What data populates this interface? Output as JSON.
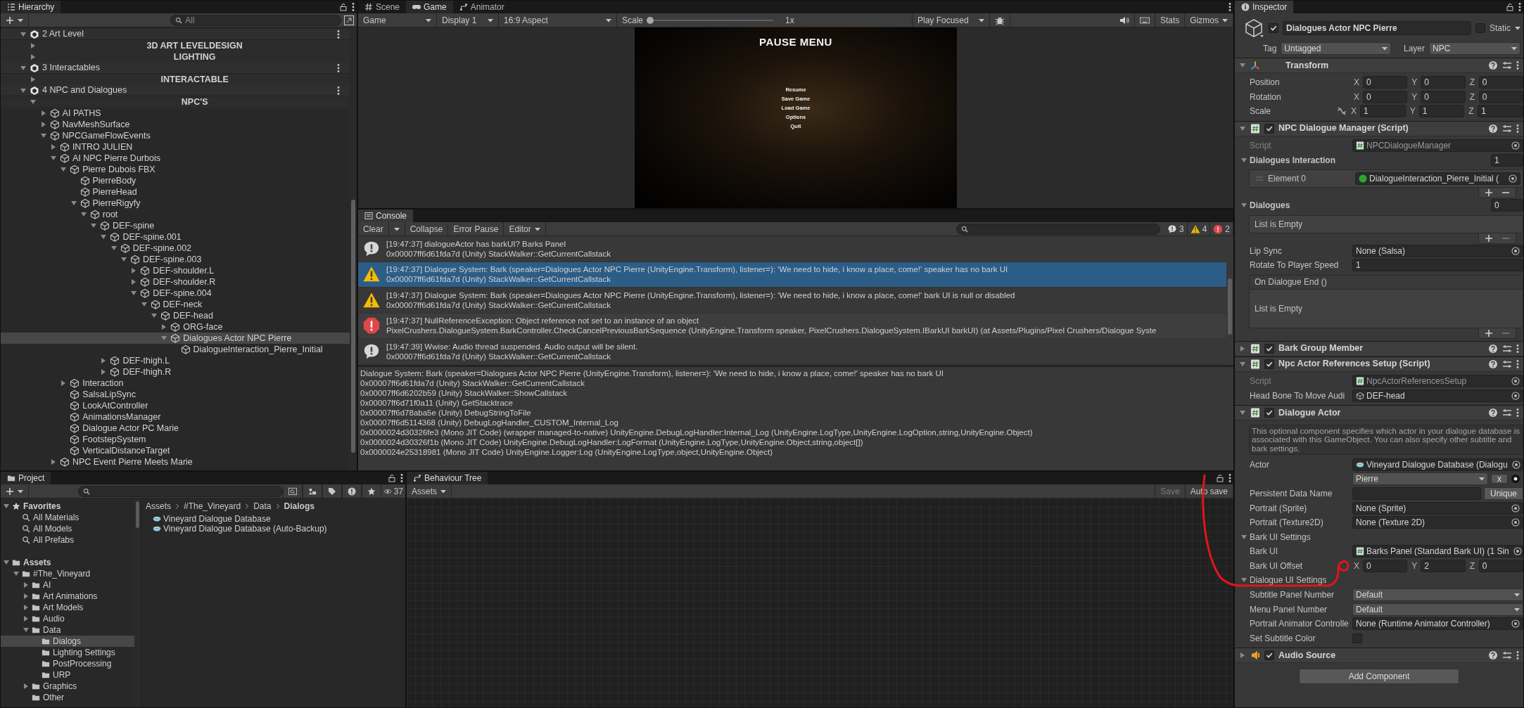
{
  "hierarchy": {
    "tab": "Hierarchy",
    "search": {
      "placeholder": "All"
    },
    "items": [
      {
        "kind": "scene",
        "label": "2 Art Level",
        "expanded": true,
        "selected": false,
        "children": [
          {
            "kind": "header",
            "label": "3D ART LEVELDESIGN",
            "expanded": false,
            "selected": false
          },
          {
            "kind": "header",
            "label": "LIGHTING",
            "expanded": false,
            "selected": false
          }
        ]
      },
      {
        "kind": "scene",
        "label": "3 Interactables",
        "expanded": true,
        "selected": false,
        "children": [
          {
            "kind": "header",
            "label": "INTERACTABLE",
            "expanded": false,
            "selected": false
          }
        ]
      },
      {
        "kind": "scene",
        "label": "4 NPC and Dialogues",
        "expanded": true,
        "selected": false,
        "children": [
          {
            "kind": "header",
            "label": "NPC'S",
            "expanded": true,
            "selected": false,
            "children": [
              {
                "kind": "object",
                "label": "AI PATHS",
                "expanded": false,
                "selected": false
              },
              {
                "kind": "object",
                "label": "NavMeshSurface",
                "expanded": false,
                "selected": false
              },
              {
                "kind": "object",
                "label": "NPCGameFlowEvents",
                "expanded": true,
                "selected": false,
                "children": [
                  {
                    "kind": "object",
                    "label": "INTRO JULIEN",
                    "expanded": false,
                    "selected": false
                  },
                  {
                    "kind": "object",
                    "label": "AI NPC Pierre Durbois",
                    "expanded": true,
                    "selected": false,
                    "children": [
                      {
                        "kind": "object",
                        "label": "Pierre Dubois FBX",
                        "expanded": true,
                        "selected": false,
                        "children": [
                          {
                            "kind": "object",
                            "label": "PierreBody",
                            "selected": false
                          },
                          {
                            "kind": "object",
                            "label": "PierreHead",
                            "selected": false
                          },
                          {
                            "kind": "object",
                            "label": "PierreRigyfy",
                            "expanded": true,
                            "selected": false,
                            "children": [
                              {
                                "kind": "object",
                                "label": "root",
                                "expanded": true,
                                "selected": false,
                                "children": [
                                  {
                                    "kind": "object",
                                    "label": "DEF-spine",
                                    "expanded": true,
                                    "selected": false,
                                    "children": [
                                      {
                                        "kind": "object",
                                        "label": "DEF-spine.001",
                                        "expanded": true,
                                        "selected": false,
                                        "children": [
                                          {
                                            "kind": "object",
                                            "label": "DEF-spine.002",
                                            "expanded": true,
                                            "selected": false,
                                            "children": [
                                              {
                                                "kind": "object",
                                                "label": "DEF-spine.003",
                                                "expanded": true,
                                                "selected": false,
                                                "children": [
                                                  {
                                                    "kind": "object",
                                                    "label": "DEF-shoulder.L",
                                                    "expanded": false,
                                                    "selected": false
                                                  },
                                                  {
                                                    "kind": "object",
                                                    "label": "DEF-shoulder.R",
                                                    "expanded": false,
                                                    "selected": false
                                                  },
                                                  {
                                                    "kind": "object",
                                                    "label": "DEF-spine.004",
                                                    "expanded": true,
                                                    "selected": false,
                                                    "children": [
                                                      {
                                                        "kind": "object",
                                                        "label": "DEF-neck",
                                                        "expanded": true,
                                                        "selected": false,
                                                        "children": [
                                                          {
                                                            "kind": "object",
                                                            "label": "DEF-head",
                                                            "expanded": true,
                                                            "selected": false,
                                                            "children": [
                                                              {
                                                                "kind": "object",
                                                                "label": "ORG-face",
                                                                "expanded": false,
                                                                "selected": false
                                                              },
                                                              {
                                                                "kind": "object",
                                                                "label": "Dialogues Actor NPC Pierre",
                                                                "expanded": true,
                                                                "selected": true,
                                                                "children": [
                                                                  {
                                                                    "kind": "object",
                                                                    "label": "DialogueInteraction_Pierre_Initial",
                                                                    "selected": false
                                                                  }
                                                                ]
                                                              }
                                                            ]
                                                          }
                                                        ]
                                                      }
                                                    ]
                                                  }
                                                ]
                                              }
                                            ]
                                          }
                                        ]
                                      },
                                      {
                                        "kind": "object",
                                        "label": "DEF-thigh.L",
                                        "expanded": false,
                                        "selected": false
                                      },
                                      {
                                        "kind": "object",
                                        "label": "DEF-thigh.R",
                                        "expanded": false,
                                        "selected": false
                                      }
                                    ]
                                  }
                                ]
                              }
                            ]
                          }
                        ]
                      },
                      {
                        "kind": "object",
                        "label": "Interaction",
                        "expanded": false,
                        "selected": false
                      },
                      {
                        "kind": "object",
                        "label": "SalsaLipSync",
                        "selected": false
                      },
                      {
                        "kind": "object",
                        "label": "LookAtController",
                        "selected": false
                      },
                      {
                        "kind": "object",
                        "label": "AnimationsManager",
                        "selected": false
                      },
                      {
                        "kind": "object",
                        "label": "Dialogue Actor PC Marie",
                        "selected": false
                      },
                      {
                        "kind": "object",
                        "label": "FootstepSystem",
                        "selected": false
                      },
                      {
                        "kind": "object",
                        "label": "VerticalDistanceTarget",
                        "selected": false
                      }
                    ]
                  },
                  {
                    "kind": "object",
                    "label": "NPC Event Pierre Meets Marie",
                    "expanded": false,
                    "selected": false
                  }
                ]
              }
            ]
          }
        ]
      }
    ]
  },
  "game": {
    "tabs": [
      {
        "label": "Scene",
        "selected": false
      },
      {
        "label": "Game",
        "selected": true
      },
      {
        "label": "Animator",
        "selected": false
      }
    ],
    "toolbar": {
      "mode": "Game",
      "display": "Display 1",
      "aspect": "16:9 Aspect",
      "scale_label": "Scale",
      "scale": {
        "level": 0
      },
      "scale_reading": "1x",
      "play_mode": "Play Focused",
      "stats": "Stats",
      "gizmos": "Gizmos"
    },
    "frame": {
      "title": "PAUSE MENU",
      "menu": [
        "Resume",
        "Save Game",
        "Load Game",
        "Options",
        "Quit"
      ]
    }
  },
  "console": {
    "tab": "Console",
    "toolbar": {
      "clear": "Clear",
      "collapse": "Collapse",
      "error_pause": "Error Pause",
      "editor": "Editor"
    },
    "counts": [
      {
        "kind": "info",
        "count": "3"
      },
      {
        "kind": "warning",
        "count": "4"
      },
      {
        "kind": "error",
        "count": "2"
      }
    ],
    "messages": [
      {
        "kind": "info",
        "selected": false,
        "lines": [
          "[19:47:37] dialogueActor has barkUI? Barks Panel",
          "0x00007ff6d61fda7d (Unity) StackWalker::GetCurrentCallstack"
        ]
      },
      {
        "kind": "warning",
        "selected": true,
        "lines": [
          "[19:47:37] Dialogue System: Bark (speaker=Dialogues Actor NPC Pierre (UnityEngine.Transform), listener=): 'We need to hide, i know a place, come!' speaker has no bark UI",
          "0x00007ff6d61fda7d (Unity) StackWalker::GetCurrentCallstack"
        ]
      },
      {
        "kind": "warning",
        "selected": false,
        "lines": [
          "[19:47:37] Dialogue System: Bark (speaker=Dialogues Actor NPC Pierre (UnityEngine.Transform), listener=): 'We need to hide, i know a place, come!' bark UI is null or disabled",
          "0x00007ff6d61fda7d (Unity) StackWalker::GetCurrentCallstack"
        ]
      },
      {
        "kind": "error",
        "selected": false,
        "lines": [
          "[19:47:37] NullReferenceException: Object reference not set to an instance of an object",
          "PixelCrushers.DialogueSystem.BarkController.CheckCancelPreviousBarkSequence (UnityEngine.Transform speaker, PixelCrushers.DialogueSystem.IBarkUI barkUI) (at Assets/Plugins/Pixel Crushers/Dialogue Syste"
        ]
      },
      {
        "kind": "info",
        "selected": false,
        "lines": [
          "[19:47:39] Wwise: Audio thread suspended. Audio output will be silent.",
          "0x00007ff6d61fda7d (Unity) StackWalker::GetCurrentCallstack"
        ]
      }
    ],
    "details": [
      "Dialogue System: Bark (speaker=Dialogues Actor NPC Pierre (UnityEngine.Transform), listener=): 'We need to hide, i know a place, come!' speaker has no bark UI",
      "0x00007ff6d61fda7d (Unity) StackWalker::GetCurrentCallstack",
      "0x00007ff6d6202b59 (Unity) StackWalker::ShowCallstack",
      "0x00007ff6d71f0a11 (Unity) GetStacktrace",
      "0x00007ff6d78aba5e (Unity) DebugStringToFile",
      "0x00007ff6d5114368 (Unity) DebugLogHandler_CUSTOM_Internal_Log",
      "0x0000024d30326fe3 (Mono JIT Code) (wrapper managed-to-native) UnityEngine.DebugLogHandler:Internal_Log (UnityEngine.LogType,UnityEngine.LogOption,string,UnityEngine.Object)",
      "0x0000024d30326f1b (Mono JIT Code) UnityEngine.DebugLogHandler:LogFormat (UnityEngine.LogType,UnityEngine.Object,string,object[])",
      "0x0000024e25318981 (Mono JIT Code) UnityEngine.Logger:Log (UnityEngine.LogType,object,UnityEngine.Object)"
    ]
  },
  "inspector": {
    "tab": "Inspector",
    "object": {
      "active": true,
      "name": "Dialogues Actor NPC Pierre",
      "static": false,
      "static_label": "Static",
      "tag_label": "Tag",
      "tag": "Untagged",
      "layer_label": "Layer",
      "layer": "NPC"
    },
    "components": [
      {
        "kind": "transform",
        "title": "Transform",
        "expanded": true,
        "rows": [
          {
            "kind": "vector3",
            "label": "Position",
            "values": [
              {
                "axis": "X",
                "value": "0"
              },
              {
                "axis": "Y",
                "value": "0"
              },
              {
                "axis": "Z",
                "value": "0"
              }
            ]
          },
          {
            "kind": "vector3",
            "label": "Rotation",
            "values": [
              {
                "axis": "X",
                "value": "0"
              },
              {
                "axis": "Y",
                "value": "0"
              },
              {
                "axis": "Z",
                "value": "0"
              }
            ]
          },
          {
            "kind": "vector3",
            "label": "Scale",
            "constrained": false,
            "values": [
              {
                "axis": "X",
                "value": "1"
              },
              {
                "axis": "Y",
                "value": "1"
              },
              {
                "axis": "Z",
                "value": "1"
              }
            ]
          }
        ]
      },
      {
        "kind": "script",
        "title": "NPC Dialogue Manager (Script)",
        "enabled": true,
        "expanded": true,
        "rows": [
          {
            "kind": "script_ref",
            "label": "Script",
            "value": "NPCDialogueManager"
          },
          {
            "kind": "list_header",
            "label": "Dialogues Interaction",
            "count": "1",
            "expanded": true
          },
          {
            "kind": "list_element",
            "label": "Element 0",
            "value": "DialogueInteraction_Pierre_Initial ("
          },
          {
            "kind": "list_buttons",
            "remove_enabled": true
          },
          {
            "kind": "list_header",
            "label": "Dialogues",
            "count": "0",
            "expanded": true
          },
          {
            "kind": "list_empty",
            "text": "List is Empty"
          },
          {
            "kind": "list_buttons",
            "remove_enabled": false
          },
          {
            "kind": "object",
            "label": "Lip Sync",
            "value": "None (Salsa)"
          },
          {
            "kind": "number",
            "label": "Rotate To Player Speed",
            "value": "1"
          },
          {
            "kind": "event",
            "label": "On Dialogue End ()",
            "text": "List is Empty"
          },
          {
            "kind": "list_buttons",
            "remove_enabled": false
          }
        ]
      },
      {
        "kind": "script",
        "title": "Bark Group Member",
        "enabled": true,
        "expanded": false
      },
      {
        "kind": "script",
        "title": "Npc Actor References Setup (Script)",
        "enabled": true,
        "expanded": true,
        "rows": [
          {
            "kind": "script_ref",
            "label": "Script",
            "value": "NpcActorReferencesSetup"
          },
          {
            "kind": "gameobject",
            "label": "Head Bone To Move Audi",
            "value": "DEF-head"
          }
        ]
      },
      {
        "kind": "script",
        "title": "Dialogue Actor",
        "enabled": true,
        "expanded": true,
        "rows": [
          {
            "kind": "help",
            "text": "This optional component specifies which actor in your dialogue database is associated with this GameObject. You can also specify other subtitle and bark settings."
          },
          {
            "kind": "asset",
            "label": "Actor",
            "value": "Vineyard Dialogue Database (Dialogu"
          },
          {
            "kind": "actor_picker",
            "value": "Pierre",
            "button": "x"
          },
          {
            "kind": "text_button",
            "label": "Persistent Data Name",
            "button": "Unique"
          },
          {
            "kind": "object",
            "label": "Portrait (Sprite)",
            "value": "None (Sprite)"
          },
          {
            "kind": "object",
            "label": "Portrait (Texture2D)",
            "value": "None (Texture 2D)"
          },
          {
            "kind": "section",
            "label": "Bark UI Settings",
            "expanded": true
          },
          {
            "kind": "component",
            "label": "Bark UI",
            "value": "Barks Panel (Standard Bark UI) (1 Sin"
          },
          {
            "kind": "vector3",
            "label": "Bark UI Offset",
            "values": [
              {
                "axis": "X",
                "value": "0"
              },
              {
                "axis": "Y",
                "value": "2"
              },
              {
                "axis": "Z",
                "value": "0"
              }
            ]
          },
          {
            "kind": "section",
            "label": "Dialogue UI Settings",
            "expanded": true
          },
          {
            "kind": "dropdown",
            "label": "Subtitle Panel Number",
            "value": "Default"
          },
          {
            "kind": "dropdown",
            "label": "Menu Panel Number",
            "value": "Default"
          },
          {
            "kind": "object",
            "label": "Portrait Animator Controlle",
            "value": "None (Runtime Animator Controller)"
          },
          {
            "kind": "checkbox",
            "label": "Set Subtitle Color",
            "checked": false
          }
        ]
      },
      {
        "kind": "audio",
        "title": "Audio Source",
        "enabled": true,
        "expanded": false
      }
    ],
    "add_component": "Add Component"
  },
  "project": {
    "tab": "Project",
    "count": "37",
    "tree": [
      {
        "kind": "favorites",
        "label": "Favorites",
        "expanded": true,
        "selected": false,
        "children": [
          {
            "kind": "search",
            "label": "All Materials",
            "selected": false
          },
          {
            "kind": "search",
            "label": "All Models",
            "selected": false
          },
          {
            "kind": "search",
            "label": "All Prefabs",
            "selected": false
          }
        ]
      },
      {
        "kind": "folder",
        "label": "Assets",
        "expanded": true,
        "selected": false,
        "children": [
          {
            "kind": "folder",
            "label": "#The_Vineyard",
            "expanded": true,
            "selected": false,
            "children": [
              {
                "kind": "folder",
                "label": "AI",
                "expanded": false,
                "selected": false
              },
              {
                "kind": "folder",
                "label": "Art Animations",
                "expanded": false,
                "selected": false
              },
              {
                "kind": "folder",
                "label": "Art Models",
                "expanded": false,
                "selected": false
              },
              {
                "kind": "folder",
                "label": "Audio",
                "expanded": false,
                "selected": false
              },
              {
                "kind": "folder",
                "label": "Data",
                "expanded": true,
                "selected": false,
                "children": [
                  {
                    "kind": "folder",
                    "label": "Dialogs",
                    "selected": true
                  },
                  {
                    "kind": "folder",
                    "label": "Lighting Settings",
                    "selected": false
                  },
                  {
                    "kind": "folder",
                    "label": "PostProcessing",
                    "selected": false
                  },
                  {
                    "kind": "folder",
                    "label": "URP",
                    "selected": false
                  }
                ]
              },
              {
                "kind": "folder",
                "label": "Graphics",
                "expanded": false,
                "selected": false
              },
              {
                "kind": "folder",
                "label": "Other",
                "selected": false
              }
            ]
          }
        ]
      }
    ],
    "breadcrumb": [
      "Assets",
      "#The_Vineyard",
      "Data",
      "Dialogs"
    ],
    "files": [
      "Vineyard Dialogue Database",
      "Vineyard Dialogue Database (Auto-Backup)"
    ]
  },
  "behaviour_tree": {
    "tab": "Behaviour Tree",
    "assets": "Assets",
    "save": {
      "label": "Save",
      "disabled": true
    },
    "auto_save": "Auto save"
  }
}
